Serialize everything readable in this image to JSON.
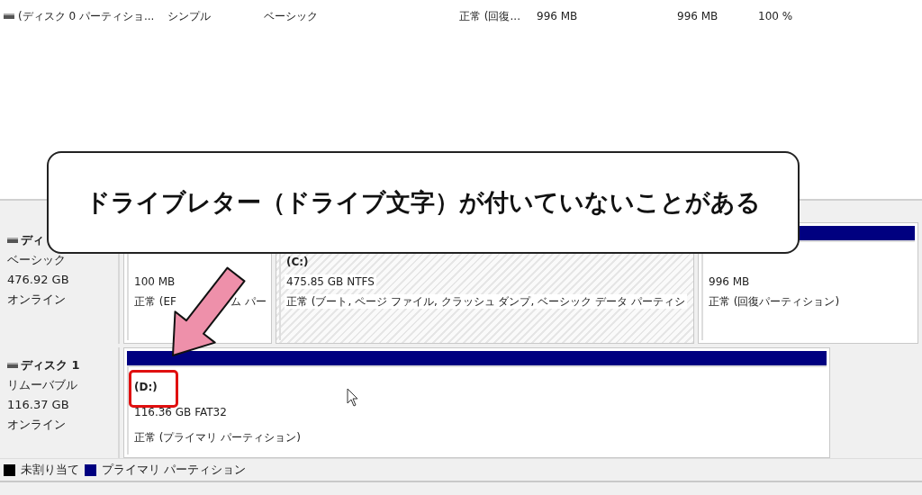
{
  "volume_list": {
    "rows": [
      {
        "cells": [
          "(ディスク 0 パーティショ...",
          "シンプル",
          "ベーシック",
          "正常 (回復...",
          "996 MB",
          "996 MB",
          "100 %"
        ]
      }
    ]
  },
  "disks": [
    {
      "name": "ディ",
      "type": "ベーシック",
      "size": "476.92 GB",
      "status": "オンライン",
      "partitions": [
        {
          "size": "100 MB",
          "status": "正常 (EF",
          "status_tail": "ム パー",
          "selected": false,
          "highlighted": false
        },
        {
          "drive": "(C:)",
          "size": "475.85 GB NTFS",
          "status": "正常 (ブート, ページ ファイル, クラッシュ ダンプ, ベーシック データ パーティシ",
          "selected": true,
          "highlighted": false
        },
        {
          "size": "996 MB",
          "status": "正常 (回復パーティション)",
          "selected": false,
          "highlighted": false
        }
      ]
    },
    {
      "name": "ディスク 1",
      "type": "リムーバブル",
      "size": "116.37 GB",
      "status": "オンライン",
      "partitions": [
        {
          "drive": "(D:)",
          "size": "116.36 GB FAT32",
          "status": "正常 (プライマリ パーティション)",
          "selected": false,
          "highlighted": true
        }
      ]
    }
  ],
  "legend": [
    {
      "label": "未割り当て",
      "color": "#000000"
    },
    {
      "label": "プライマリ パーティション",
      "color": "#000080"
    }
  ],
  "callout": {
    "text": "ドライブレター（ドライブ文字）が付いていないことがある"
  }
}
